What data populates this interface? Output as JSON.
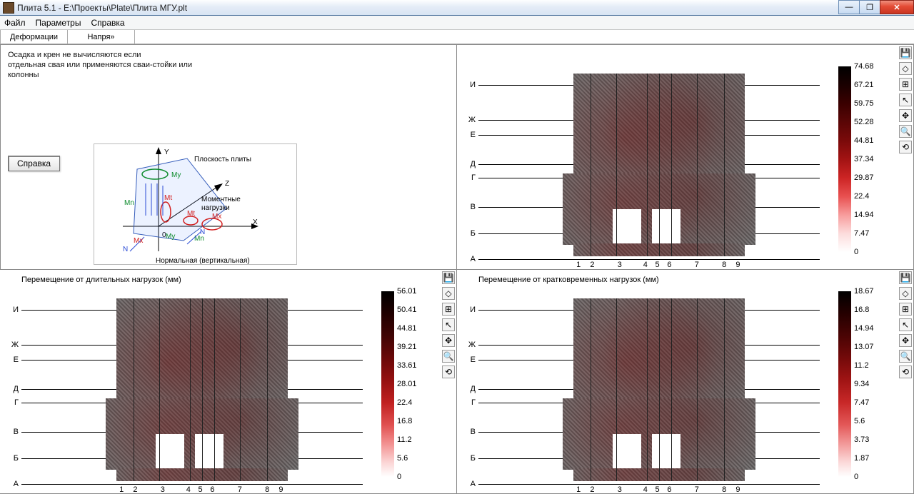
{
  "window": {
    "title": "Плита 5.1 - E:\\Проекты\\Plate\\Плита МГУ.plt"
  },
  "menu": {
    "file": "Файл",
    "params": "Параметры",
    "help": "Справка"
  },
  "tabs": {
    "deform": "Деформации",
    "stress": "Напря»"
  },
  "quad1": {
    "msg_l1": "Осадка и крен не вычисляются если",
    "msg_l2": "отдельная свая или применяются сваи-стойки или",
    "msg_l3": "колонны",
    "btn_help": "Справка",
    "diag": {
      "Y": "Y",
      "X": "X",
      "Z": "Z",
      "O": "0",
      "plane": "Плоскость плиты",
      "moment1": "Моментные",
      "moment2": "нагрузки",
      "normal": "Нормальная (вертикальная)",
      "Mn": "Mn",
      "Mt": "Mt",
      "Mx": "Mx",
      "My": "My",
      "N": "N"
    }
  },
  "axis_rows": [
    "И",
    "Ж",
    "Е",
    "Д",
    "Г",
    "В",
    "Б",
    "А"
  ],
  "axis_cols": [
    "1",
    "2",
    "3",
    "4",
    "5",
    "6",
    "7",
    "8",
    "9"
  ],
  "chart_data": [
    {
      "id": "top_right",
      "type": "heatmap",
      "title": "",
      "row_labels": [
        "И",
        "Ж",
        "Е",
        "Д",
        "Г",
        "В",
        "Б",
        "А"
      ],
      "col_labels": [
        "1",
        "2",
        "3",
        "4",
        "5",
        "6",
        "7",
        "8",
        "9"
      ],
      "colorbar_values": [
        74.68,
        67.21,
        59.75,
        52.28,
        44.81,
        37.34,
        29.87,
        22.4,
        14.94,
        7.47,
        0
      ],
      "unit": ""
    },
    {
      "id": "bottom_left",
      "type": "heatmap",
      "title": "Перемещение от длительных нагрузок (мм)",
      "row_labels": [
        "И",
        "Ж",
        "Е",
        "Д",
        "Г",
        "В",
        "Б",
        "А"
      ],
      "col_labels": [
        "1",
        "2",
        "3",
        "4",
        "5",
        "6",
        "7",
        "8",
        "9"
      ],
      "colorbar_values": [
        56.01,
        50.41,
        44.81,
        39.21,
        33.61,
        28.01,
        22.4,
        16.8,
        11.2,
        5.6,
        0
      ],
      "unit": "мм"
    },
    {
      "id": "bottom_right",
      "type": "heatmap",
      "title": "Перемещение от кратковременных нагрузок (мм)",
      "row_labels": [
        "И",
        "Ж",
        "Е",
        "Д",
        "Г",
        "В",
        "Б",
        "А"
      ],
      "col_labels": [
        "1",
        "2",
        "3",
        "4",
        "5",
        "6",
        "7",
        "8",
        "9"
      ],
      "colorbar_values": [
        18.67,
        16.8,
        14.94,
        13.07,
        11.2,
        9.34,
        7.47,
        5.6,
        3.73,
        1.87,
        0
      ],
      "unit": "мм"
    }
  ],
  "sidetools": {
    "save": "save",
    "eraser": "eraser",
    "grid": "grid",
    "pointer": "pointer",
    "pan": "pan",
    "zoom": "zoom",
    "rotate": "rotate"
  }
}
